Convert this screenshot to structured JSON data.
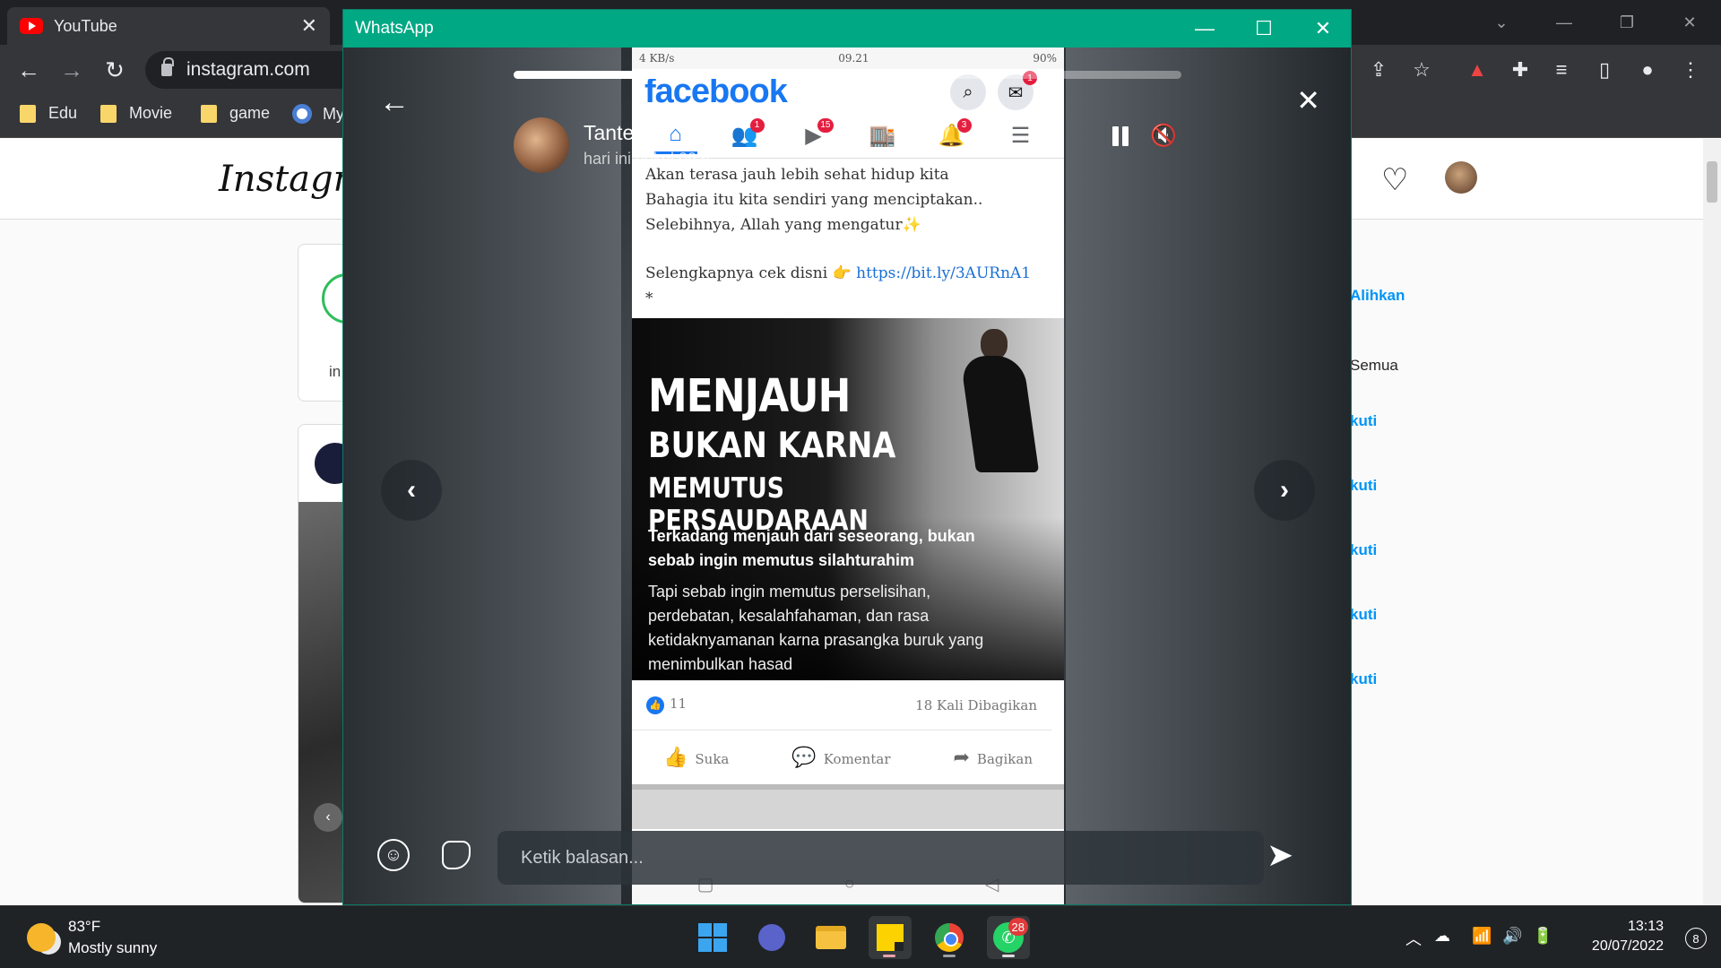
{
  "browser": {
    "tab_title": "YouTube",
    "url": "instagram.com",
    "bookmarks": [
      "Edu",
      "Movie",
      "game",
      "My"
    ]
  },
  "instagram": {
    "logo": "Instagram",
    "story_label": "in",
    "sidebar": {
      "switch": "Alihkan",
      "see_all": "Semua",
      "follow": [
        "kuti",
        "kuti",
        "kuti",
        "kuti",
        "kuti"
      ]
    }
  },
  "whatsapp": {
    "window_title": "WhatsApp",
    "story": {
      "contact": "Tante Tut",
      "time": "hari ini pukul 09.5",
      "progress": 0.61,
      "reply_placeholder": "Ketik balasan..."
    },
    "phone": {
      "status": {
        "left": "4 KB/s",
        "time": "09.21",
        "battery": "90%"
      },
      "fb_logo": "facebook",
      "badges": {
        "messenger": "1",
        "friends": "1",
        "video": "15",
        "notifications": "3"
      },
      "post_lines": [
        "Akan terasa jauh lebih sehat hidup kita",
        "Bahagia itu kita sendiri yang menciptakan..",
        "Selebihnya, Allah yang mengatur✨"
      ],
      "post_more": "Selengkapnya cek disni 👉",
      "post_link": "https://bit.ly/3AURnA1",
      "post_star": "*",
      "image": {
        "h1": "MENJAUH",
        "h2": "BUKAN KARNA",
        "h3": "MEMUTUS PERSAUDARAAN",
        "p1": "Terkadang menjauh dari seseorang, bukan sebab ingin memutus silahturahim",
        "p2": "Tapi sebab ingin memutus perselisihan, perdebatan, kesalahfahaman, dan rasa ketidaknyamanan karna prasangka buruk yang menimbulkan hasad"
      },
      "likes": "11",
      "shares": "18 Kali Dibagikan",
      "actions": {
        "like": "Suka",
        "comment": "Komentar",
        "share": "Bagikan"
      }
    }
  },
  "taskbar": {
    "weather_temp": "83°F",
    "weather_desc": "Mostly sunny",
    "whatsapp_badge": "28",
    "time": "13:13",
    "date": "20/07/2022",
    "notifications": "8"
  }
}
